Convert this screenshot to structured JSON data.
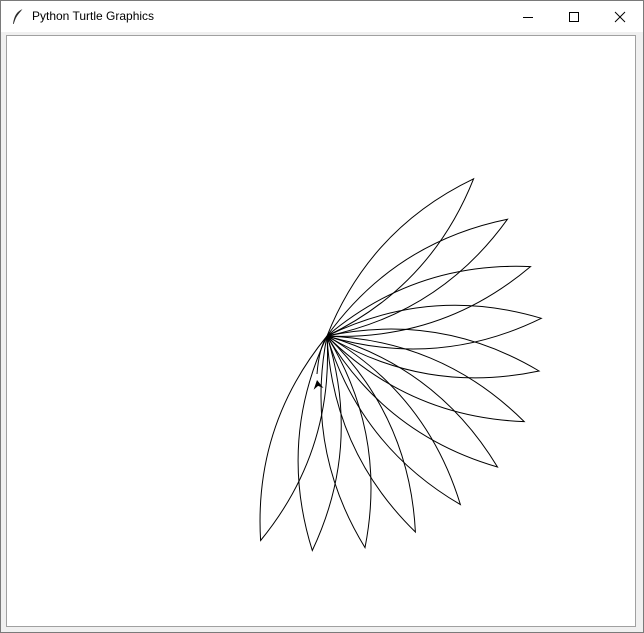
{
  "window": {
    "title": "Python Turtle Graphics",
    "app_icon": "feather-icon",
    "controls": [
      "minimize-icon",
      "maximize-icon",
      "close-icon"
    ]
  },
  "drawing": {
    "stroke_color": "#000000",
    "background": "#ffffff",
    "petal_count": 12,
    "turtle_heading_deg": 260
  }
}
